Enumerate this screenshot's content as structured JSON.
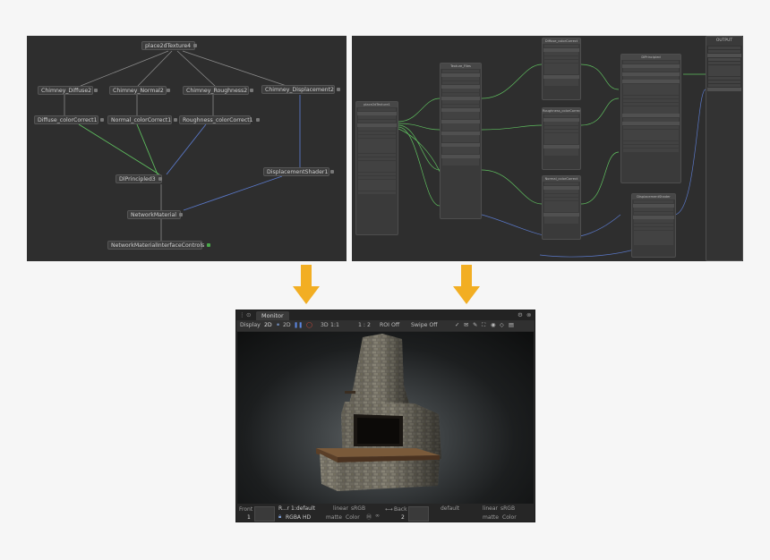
{
  "left_graph": {
    "nodes": {
      "place2d": "place2dTexture4",
      "diffuse": "Chimney_Diffuse2",
      "normal": "Chimney_Normal2",
      "roughness": "Chimney_Roughness2",
      "displacement": "Chimney_Displacement2",
      "diffuse_cc": "Diffuse_colorCorrect1",
      "normal_cc": "Normal_colorCorrect1",
      "roughness_cc": "Roughness_colorCorrect1",
      "principled": "DlPrincipled3",
      "disp_shader": "DisplacementShader1",
      "network_material": "NetworkMaterial",
      "interface_controls": "NetworkMaterialInterfaceControls"
    }
  },
  "right_graph": {
    "output_title": "OUTPUT",
    "nodes": {
      "place": "place2dTexture1",
      "files": "Texture_Files",
      "diffuse_cc": "Diffuse_colorCorrect",
      "roughness_cc": "Roughness_colorCorrect",
      "normal_cc": "Normal_colorCorrect",
      "principled": "DlPrincipled",
      "displacement": "DisplacementShader"
    }
  },
  "monitor": {
    "tab_label": "Monitor",
    "toolbar": {
      "display": "Display",
      "mode_2d": "2D",
      "mode_3d": "3D",
      "zoom": "1 : 2",
      "roi": "ROI Off",
      "swipe": "Swipe Off"
    },
    "bottom": {
      "front_label": "Front",
      "front_value": "1",
      "layer": "R...r 1:default",
      "rgba": "RGBA HD",
      "lin1": "linear",
      "srgb1": "sRGB",
      "matte": "matte",
      "color": "Color",
      "back_label": "Back",
      "back_value": "2",
      "default2": "default",
      "lin2": "linear",
      "srgb2": "sRGB",
      "matte2": "matte",
      "color2": "Color"
    }
  },
  "colors": {
    "arrow": "#f2ae23",
    "wire_gray": "#8a8a8a",
    "wire_green": "#5fbf5f",
    "wire_blue": "#5a78c8"
  }
}
